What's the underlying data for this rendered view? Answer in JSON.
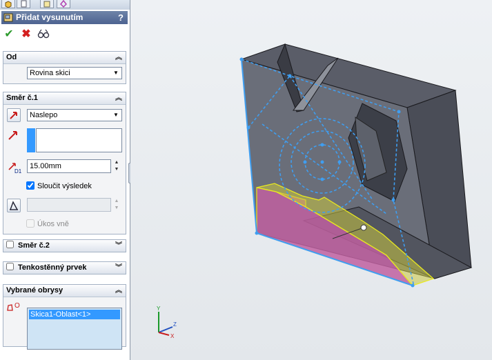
{
  "panel": {
    "title": "Přidat vysunutím",
    "help": "?",
    "colors": {
      "title_bg": "#5b6f9b",
      "accent": "#3399ff",
      "ok": "#2e9b2e",
      "cancel": "#d42020"
    }
  },
  "sections": {
    "from": {
      "header": "Od",
      "select_value": "Rovina skici"
    },
    "direction1": {
      "header": "Směr č.1",
      "end_condition": "Naslepo",
      "depth_value": "15.00mm",
      "merge_label": "Sloučit výsledek",
      "draft_label": "Úkos vně",
      "depth_tag": "D1"
    },
    "direction2": {
      "header": "Směr č.2"
    },
    "thin": {
      "header": "Tenkostěnný prvek"
    },
    "contours": {
      "header": "Vybrané obrysy",
      "items": [
        "Skica1-Oblast<1>"
      ],
      "icon_label": "O"
    }
  },
  "triad": {
    "x": "X",
    "y": "Y",
    "z": "Z"
  },
  "icons": [
    "part-tab-icon",
    "propertymanager-tab-icon",
    "configuration-tab-icon",
    "dimxpert-tab-icon",
    "extrude-icon",
    "ok-icon",
    "cancel-icon",
    "preview-icon",
    "reverse-direction-icon",
    "direction-vector-icon",
    "depth-icon",
    "draft-icon",
    "contour-icon"
  ]
}
